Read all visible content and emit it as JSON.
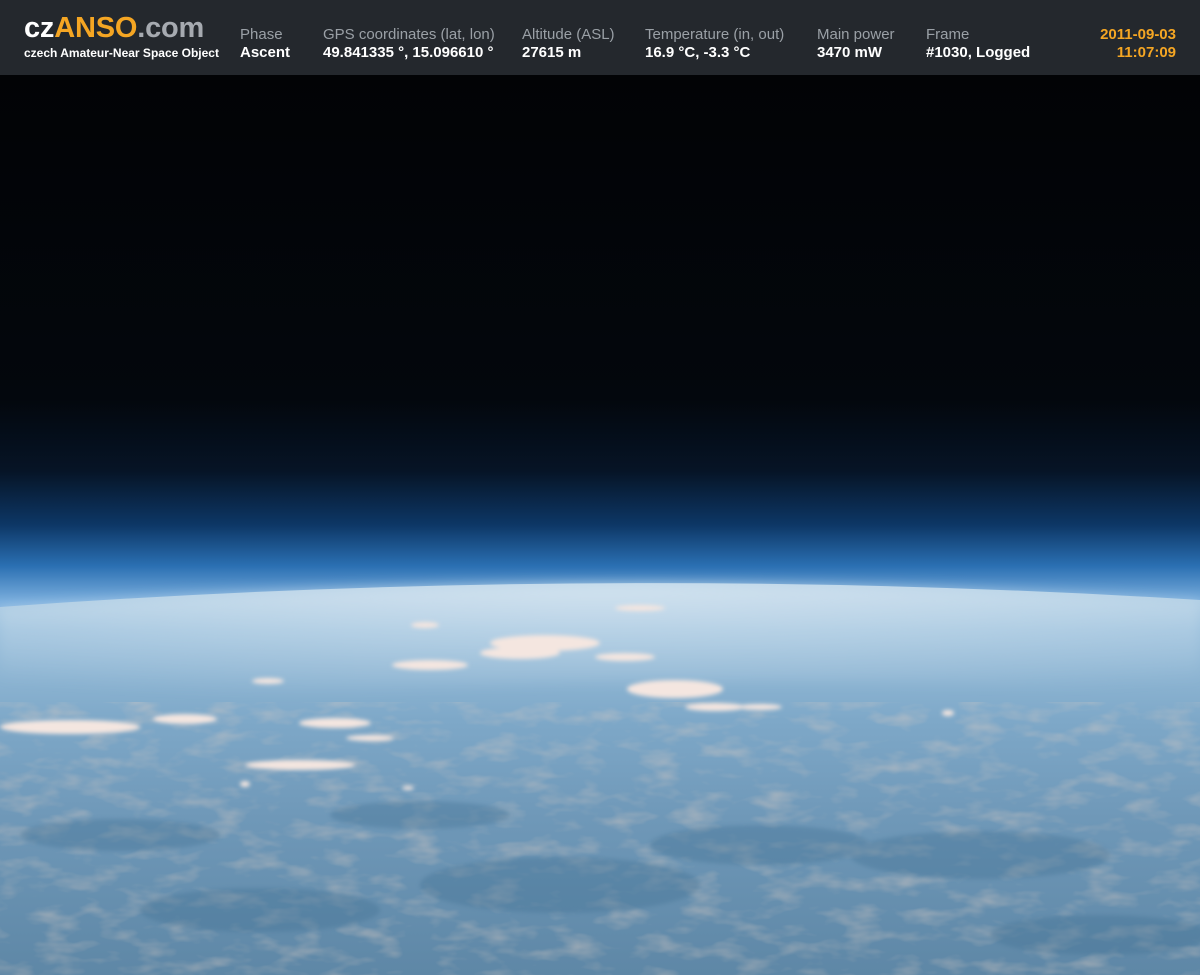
{
  "header": {
    "logo": {
      "part1": "cz",
      "part2": "ANSO",
      "part3": ".com",
      "subtitle": "czech Amateur-Near Space Object"
    },
    "fields": [
      {
        "label": "Phase",
        "value": "Ascent"
      },
      {
        "label": "GPS coordinates (lat, lon)",
        "value": "49.841335 °, 15.096610 °"
      },
      {
        "label": "Altitude (ASL)",
        "value": "27615 m"
      },
      {
        "label": "Temperature (in, out)",
        "value": "16.9 °C, -3.3 °C"
      },
      {
        "label": "Main power",
        "value": "3470 mW"
      },
      {
        "label": "Frame",
        "value": "#1030, Logged"
      }
    ],
    "date": "2011-09-03",
    "time": "11:07:09"
  },
  "colors": {
    "bar_background": "#24282d",
    "accent": "#f5a623",
    "label_gray": "#9aa0a6"
  }
}
